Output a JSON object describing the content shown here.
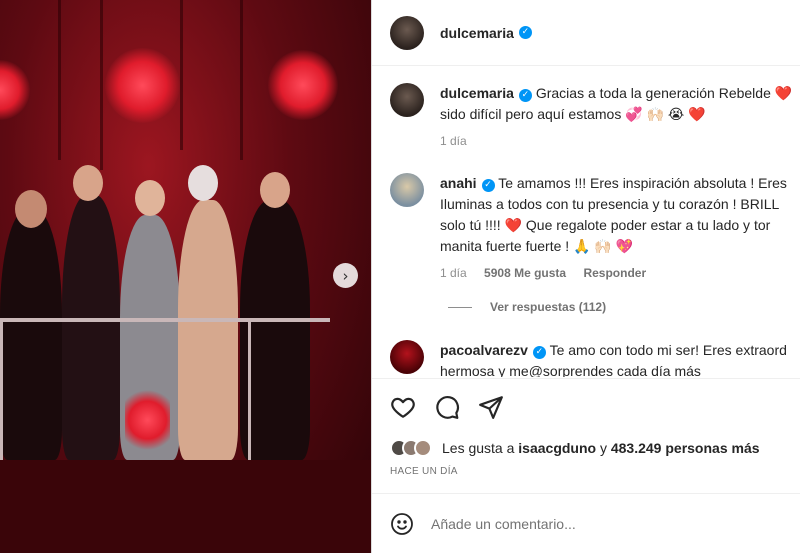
{
  "post": {
    "author": "dulcemaria",
    "next_glyph": "›"
  },
  "caption": {
    "user": "dulcemaria",
    "text_line1": "Gracias a toda la generación Rebelde ❤️",
    "text_line2": "sido difícil pero aquí estamos 💞 🙌🏻 😭 ❤️",
    "time": "1 día"
  },
  "comments": [
    {
      "user": "anahi",
      "line1": "Te amamos !!! Eres inspiración absoluta ! Eres",
      "line2": "Iluminas a todos con tu presencia y tu corazón ! BRILL",
      "line3": "solo tú !!!! ❤️  Que regalote poder estar a tu lado y tor",
      "line4": "manita fuerte fuerte ! 🙏 🙌🏻 💖",
      "time": "1 día",
      "likes": "5908 Me gusta",
      "reply": "Responder",
      "view_replies": "Ver respuestas (112)"
    },
    {
      "user": "pacoalvarezv",
      "line1": "Te amo con todo mi ser! Eres extraord",
      "line2": "hermosa y me@sorprendes cada día más"
    }
  ],
  "likes": {
    "prefix": "Les gusta a",
    "user": "isaacgduno",
    "connector": "y",
    "count": "483.249 personas más",
    "time_ago": "HACE UN DÍA"
  },
  "composer": {
    "placeholder": "Añade un comentario..."
  }
}
